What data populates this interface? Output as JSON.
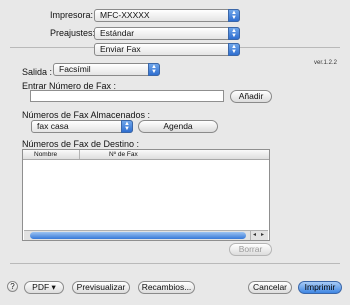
{
  "printer": {
    "label": "Impresora:",
    "value": "MFC-XXXXX"
  },
  "presets": {
    "label": "Preajustes:",
    "value": "Estándar"
  },
  "panel": {
    "value": "Enviar Fax"
  },
  "version": "ver.1.2.2",
  "output": {
    "label": "Salida :",
    "value": "Facsímil"
  },
  "fax_entry": {
    "label": "Entrar Número de Fax :",
    "value": "",
    "add_button": "Añadir"
  },
  "stored": {
    "label": "Números de Fax Almacenados :",
    "value": "fax casa",
    "agenda_button": "Agenda"
  },
  "destination": {
    "label": "Números de Fax de Destino :",
    "columns": [
      "Nombre",
      "Nº de Fax"
    ],
    "delete_button": "Borrar"
  },
  "footer": {
    "help": "?",
    "pdf": "PDF ▾",
    "preview": "Previsualizar",
    "supplies": "Recambios...",
    "cancel": "Cancelar",
    "print": "Imprimir"
  },
  "colors": {
    "accent": "#3f86e3",
    "window_bg": "#e8e8e8"
  }
}
